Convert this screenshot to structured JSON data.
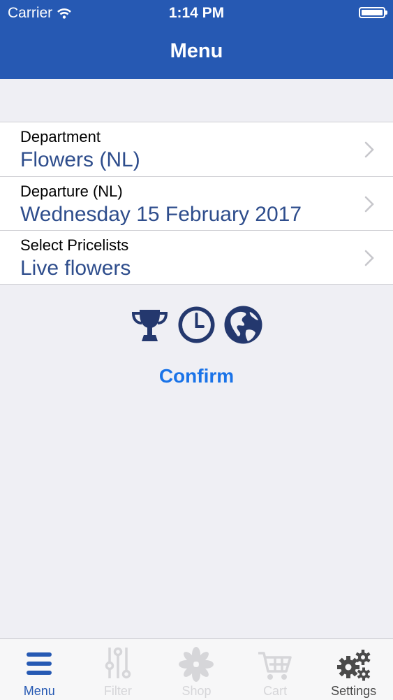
{
  "status_bar": {
    "carrier": "Carrier",
    "time": "1:14 PM"
  },
  "nav": {
    "title": "Menu"
  },
  "rows": [
    {
      "label": "Department",
      "value": "Flowers (NL)"
    },
    {
      "label": "Departure (NL)",
      "value": "Wednesday 15 February 2017"
    },
    {
      "label": "Select Pricelists",
      "value": "Live flowers"
    }
  ],
  "icons": [
    "trophy-icon",
    "clock-icon",
    "globe-icon"
  ],
  "confirm_label": "Confirm",
  "tabs": [
    {
      "label": "Menu",
      "icon": "menu-icon",
      "state": "active"
    },
    {
      "label": "Filter",
      "icon": "sliders-icon",
      "state": "disabled"
    },
    {
      "label": "Shop",
      "icon": "flower-icon",
      "state": "disabled"
    },
    {
      "label": "Cart",
      "icon": "cart-icon",
      "state": "disabled"
    },
    {
      "label": "Settings",
      "icon": "gears-icon",
      "state": "normal"
    }
  ],
  "colors": {
    "header": "#2659b3",
    "value_text": "#2e4d8c",
    "accent": "#1a73e8",
    "icon": "#24386e"
  }
}
